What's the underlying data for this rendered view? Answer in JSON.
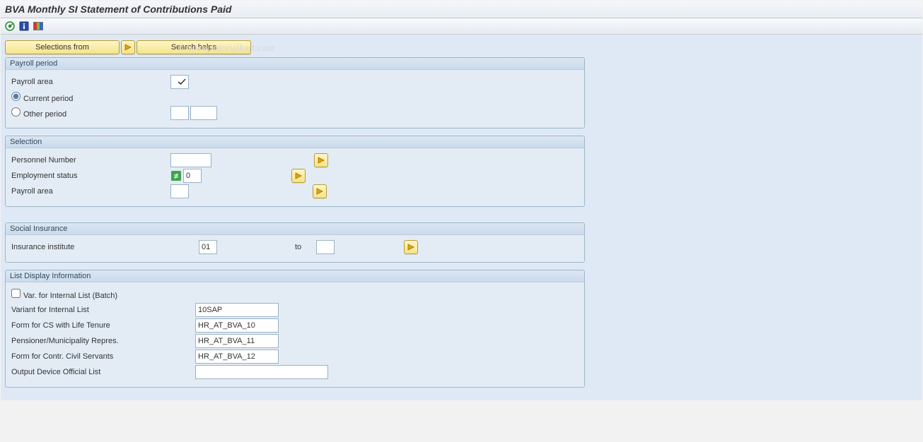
{
  "title": "BVA Monthly SI Statement of Contributions Paid",
  "watermark": "© www.tutorialkart.com",
  "toolbar": {
    "selections_from": "Selections from",
    "search_helps": "Search helps"
  },
  "groups": {
    "payroll_period": {
      "title": "Payroll period",
      "payroll_area_label": "Payroll area",
      "payroll_area_value": "",
      "current_period_label": "Current period",
      "other_period_label": "Other period",
      "other_period_val1": "",
      "other_period_val2": ""
    },
    "selection": {
      "title": "Selection",
      "personnel_number_label": "Personnel Number",
      "personnel_number_value": "",
      "employment_status_label": "Employment status",
      "employment_status_value": "0",
      "payroll_area_label": "Payroll area",
      "payroll_area_value": ""
    },
    "social_insurance": {
      "title": "Social Insurance",
      "insurance_institute_label": "Insurance institute",
      "insurance_institute_from": "01",
      "to_label": "to",
      "insurance_institute_to": ""
    },
    "list_display": {
      "title": "List Display Information",
      "var_internal_batch_label": "Var. for Internal List (Batch)",
      "variant_internal_list_label": "Variant for Internal List",
      "variant_internal_list_value": "10SAP",
      "form_cs_life_tenure_label": "Form for CS with Life Tenure",
      "form_cs_life_tenure_value": "HR_AT_BVA_10",
      "pensioner_munic_label": "Pensioner/Municipality Repres.",
      "pensioner_munic_value": "HR_AT_BVA_11",
      "form_contr_civil_label": "Form for Contr. Civil Servants",
      "form_contr_civil_value": "HR_AT_BVA_12",
      "output_device_label": "Output Device Official List",
      "output_device_value": ""
    }
  }
}
